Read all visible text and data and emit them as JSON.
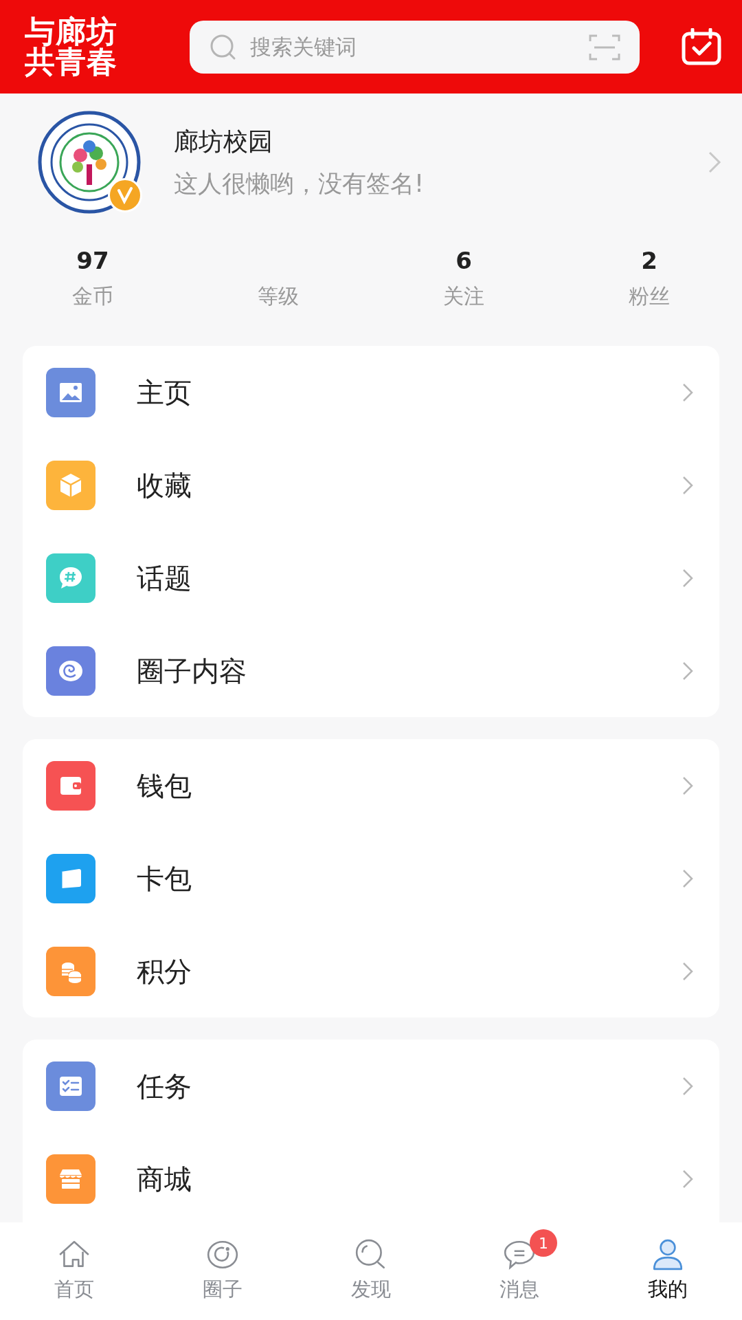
{
  "header": {
    "logo_lines": [
      "与廊坊",
      "共青春"
    ],
    "search_placeholder": "搜索关键词"
  },
  "profile": {
    "name": "廊坊校园",
    "signature": "这人很懒哟，没有签名!",
    "verified": true
  },
  "stats": [
    {
      "value": "97",
      "label": "金币"
    },
    {
      "label": "等级"
    },
    {
      "value": "6",
      "label": "关注"
    },
    {
      "value": "2",
      "label": "粉丝"
    }
  ],
  "menu_groups": [
    {
      "items": [
        {
          "label": "主页",
          "kind": "image",
          "color": "#6b8cdc"
        },
        {
          "label": "收藏",
          "kind": "cube",
          "color": "#fdb43c"
        },
        {
          "label": "话题",
          "kind": "topic",
          "color": "#3ecfc6"
        },
        {
          "label": "圈子内容",
          "kind": "swirl",
          "color": "#6a82de"
        }
      ]
    },
    {
      "items": [
        {
          "label": "钱包",
          "kind": "wallet",
          "color": "#f65253"
        },
        {
          "label": "卡包",
          "kind": "card",
          "color": "#1ea1ef"
        },
        {
          "label": "积分",
          "kind": "coins",
          "color": "#fd9438"
        }
      ]
    },
    {
      "items": [
        {
          "label": "任务",
          "kind": "tasks",
          "color": "#6b8cdc"
        },
        {
          "label": "商城",
          "kind": "shop",
          "color": "#fd9438"
        }
      ]
    }
  ],
  "tabbar": [
    {
      "label": "首页",
      "kind": "home",
      "selected": false
    },
    {
      "label": "圈子",
      "kind": "circle",
      "selected": false
    },
    {
      "label": "发现",
      "kind": "discover",
      "selected": false
    },
    {
      "label": "消息",
      "kind": "message",
      "selected": false,
      "badge": "1"
    },
    {
      "label": "我的",
      "kind": "me",
      "selected": true
    }
  ]
}
